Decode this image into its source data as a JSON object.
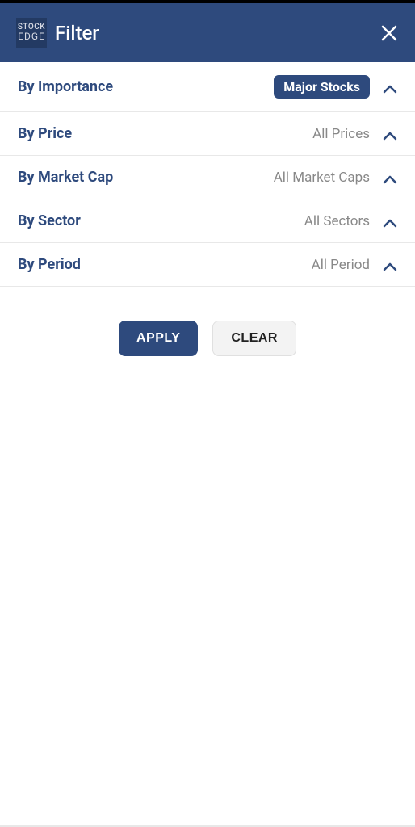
{
  "header": {
    "logo_top": "STOCK",
    "logo_bottom": "EDGE",
    "title": "Filter"
  },
  "filters": [
    {
      "label": "By Importance",
      "value": "Major Stocks",
      "badge": true
    },
    {
      "label": "By Price",
      "value": "All Prices",
      "badge": false
    },
    {
      "label": "By Market Cap",
      "value": "All Market Caps",
      "badge": false
    },
    {
      "label": "By Sector",
      "value": "All Sectors",
      "badge": false
    },
    {
      "label": "By Period",
      "value": "All Period",
      "badge": false
    }
  ],
  "actions": {
    "apply": "APPLY",
    "clear": "CLEAR"
  }
}
